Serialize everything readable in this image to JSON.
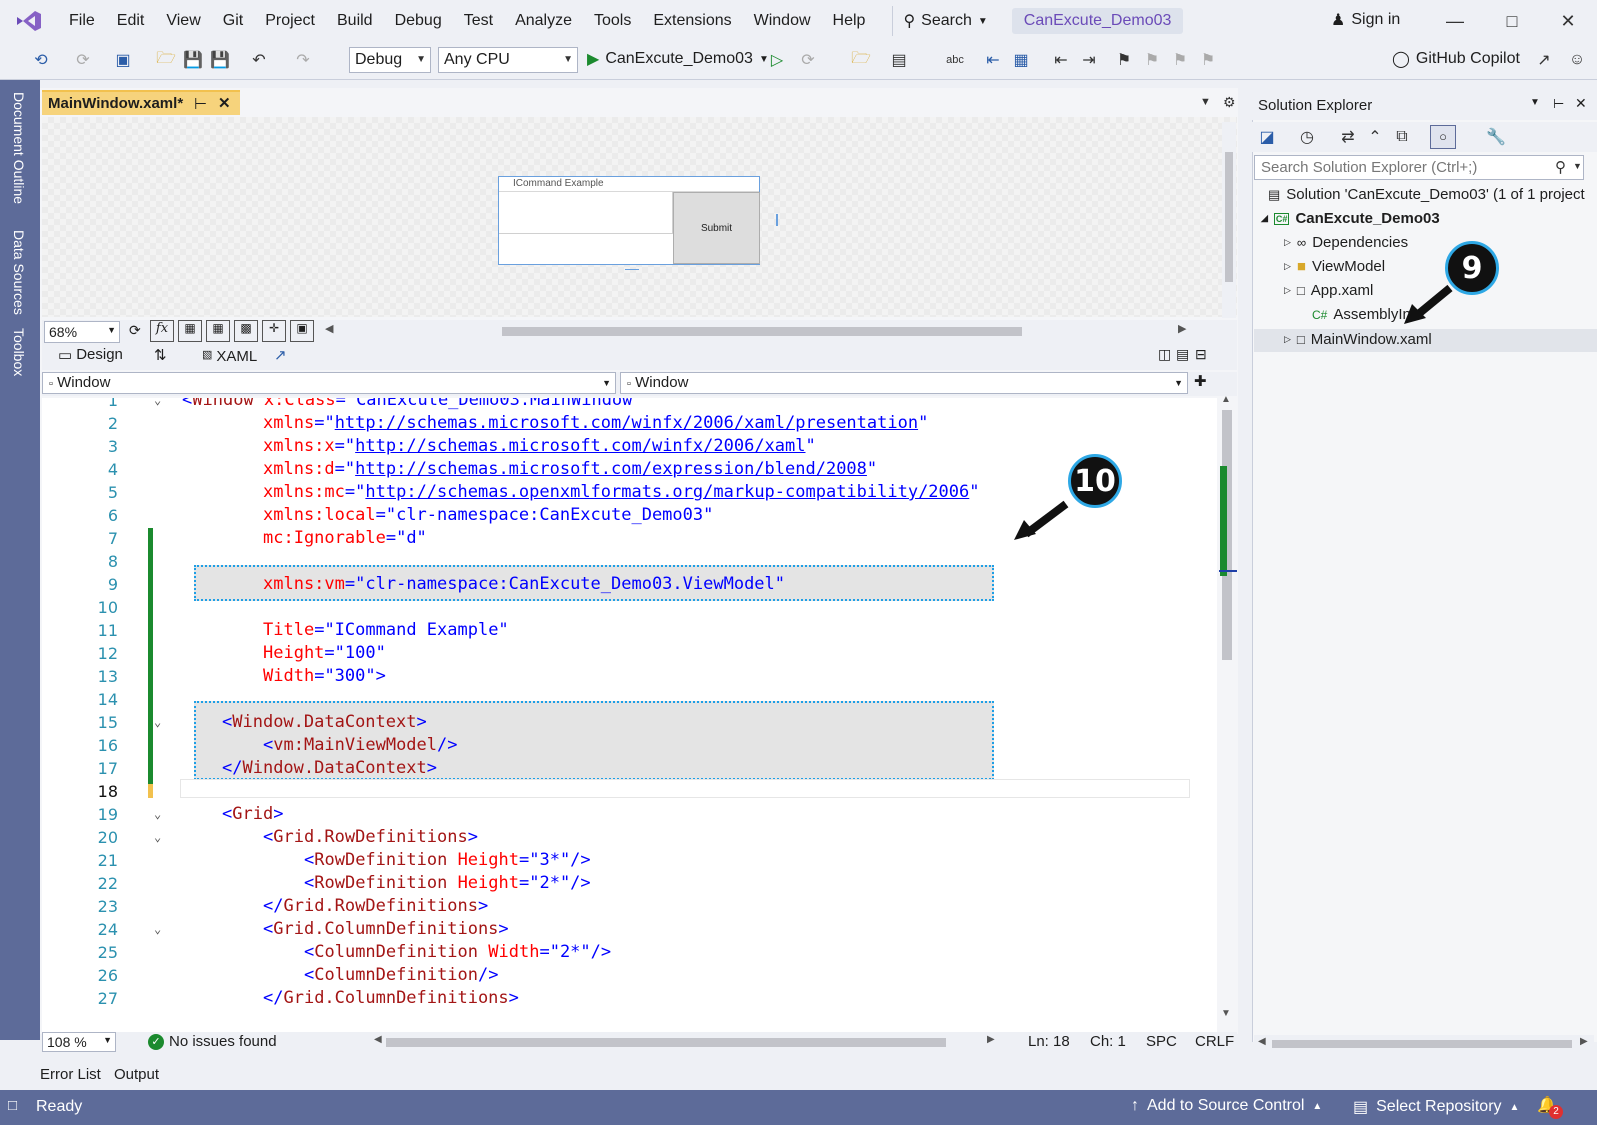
{
  "menu": [
    "File",
    "Edit",
    "View",
    "Git",
    "Project",
    "Build",
    "Debug",
    "Test",
    "Analyze",
    "Tools",
    "Extensions",
    "Window",
    "Help"
  ],
  "search_label": "Search",
  "solution_title": "CanExcute_Demo03",
  "sign_in": "Sign in",
  "toolbar": {
    "config": "Debug",
    "platform": "Any CPU",
    "run_target": "CanExcute_Demo03",
    "copilot": "GitHub Copilot"
  },
  "left_rail": [
    "Document Outline",
    "Data Sources",
    "Toolbox"
  ],
  "doc_tab": "MainWindow.xaml*",
  "designer": {
    "window_title": "ICommand Example",
    "button_label": "Submit"
  },
  "zoom": "68%",
  "view_tabs": {
    "design": "Design",
    "xaml": "XAML"
  },
  "nav": {
    "left": "Window",
    "right": "Window"
  },
  "editor_zoom": "108 %",
  "issues": "No issues found",
  "cursor": {
    "ln": "Ln: 18",
    "ch": "Ch: 1",
    "spc": "SPC",
    "crlf": "CRLF"
  },
  "solution_explorer": {
    "title": "Solution Explorer",
    "search_placeholder": "Search Solution Explorer (Ctrl+;)",
    "items": [
      {
        "label": "Solution 'CanExcute_Demo03' (1 of 1 project"
      },
      {
        "label": "CanExcute_Demo03"
      },
      {
        "label": "Dependencies"
      },
      {
        "label": "ViewModel"
      },
      {
        "label": "App.xaml"
      },
      {
        "label": "AssemblyIn"
      },
      {
        "label": "MainWindow.xaml"
      }
    ]
  },
  "badges": {
    "nine": "9",
    "ten": "10"
  },
  "bottom_tabs": [
    "Error List",
    "Output"
  ],
  "status": {
    "ready": "Ready",
    "source_control": "Add to Source Control",
    "repo": "Select Repository",
    "notif_count": "2"
  },
  "code_lines": [
    "1",
    "2",
    "3",
    "4",
    "5",
    "6",
    "7",
    "8",
    "9",
    "10",
    "11",
    "12",
    "13",
    "14",
    "15",
    "16",
    "17",
    "18",
    "19",
    "20",
    "21",
    "22",
    "23",
    "24",
    "25",
    "26",
    "27"
  ]
}
